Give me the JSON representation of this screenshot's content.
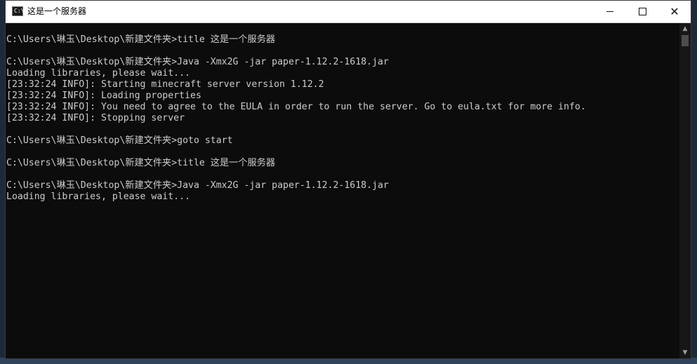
{
  "window": {
    "title": "这是一个服务器",
    "app_icon_label": "C:\\"
  },
  "titlebar_buttons": {
    "minimize": "minimize",
    "maximize": "maximize",
    "close": "✕"
  },
  "console": {
    "lines": [
      "C:\\Users\\琳玉\\Desktop\\新建文件夹>title 这是一个服务器",
      "",
      "C:\\Users\\琳玉\\Desktop\\新建文件夹>Java -Xmx2G -jar paper-1.12.2-1618.jar",
      "Loading libraries, please wait...",
      "[23:32:24 INFO]: Starting minecraft server version 1.12.2",
      "[23:32:24 INFO]: Loading properties",
      "[23:32:24 INFO]: You need to agree to the EULA in order to run the server. Go to eula.txt for more info.",
      "[23:32:24 INFO]: Stopping server",
      "",
      "C:\\Users\\琳玉\\Desktop\\新建文件夹>goto start",
      "",
      "C:\\Users\\琳玉\\Desktop\\新建文件夹>title 这是一个服务器",
      "",
      "C:\\Users\\琳玉\\Desktop\\新建文件夹>Java -Xmx2G -jar paper-1.12.2-1618.jar",
      "Loading libraries, please wait..."
    ]
  },
  "scrollbar": {
    "up_arrow": "▲",
    "down_arrow": "▼"
  },
  "colors": {
    "console_bg": "#0c0c0c",
    "console_text": "#cccccc",
    "titlebar_bg": "#ffffff"
  }
}
